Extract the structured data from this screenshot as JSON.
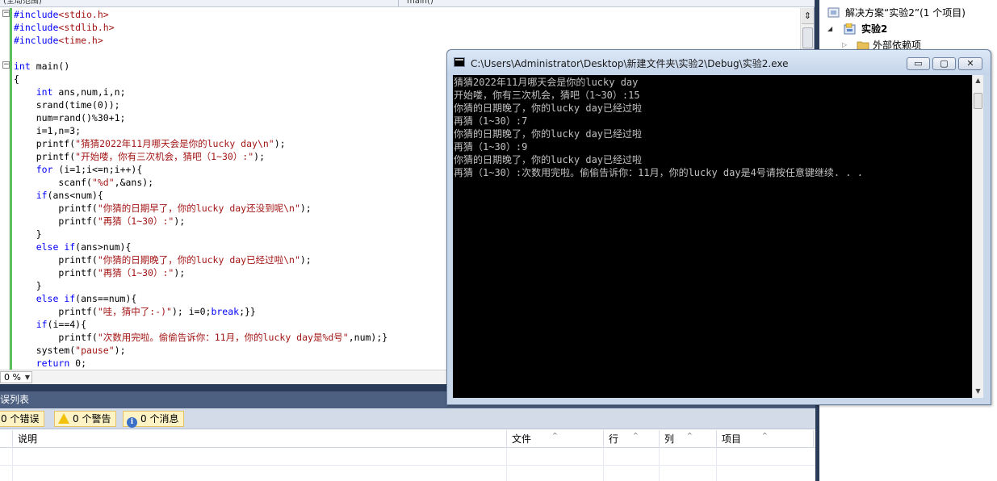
{
  "editor": {
    "nav_scope": "(全局范围)",
    "nav_function": "main()",
    "zoom_level": "0 %",
    "code_lines": [
      [
        {
          "t": "#include",
          "c": "pp"
        },
        {
          "t": "<stdio.h>",
          "c": "str"
        }
      ],
      [
        {
          "t": "#include",
          "c": "pp"
        },
        {
          "t": "<stdlib.h>",
          "c": "str"
        }
      ],
      [
        {
          "t": "#include",
          "c": "pp"
        },
        {
          "t": "<time.h>",
          "c": "str"
        }
      ],
      [],
      [
        {
          "t": "int",
          "c": "kw"
        },
        {
          "t": " main()",
          "c": ""
        }
      ],
      [
        {
          "t": "{",
          "c": ""
        }
      ],
      [
        {
          "t": "    ",
          "c": ""
        },
        {
          "t": "int",
          "c": "kw"
        },
        {
          "t": " ans,num,i,n;",
          "c": ""
        }
      ],
      [
        {
          "t": "    srand(time(0));",
          "c": ""
        }
      ],
      [
        {
          "t": "    num=rand()%30+1;",
          "c": ""
        }
      ],
      [
        {
          "t": "    i=1,n=3;",
          "c": ""
        }
      ],
      [
        {
          "t": "    printf(",
          "c": ""
        },
        {
          "t": "\"猜猜2022年11月哪天会是你的lucky day\\n\"",
          "c": "str"
        },
        {
          "t": ");",
          "c": ""
        }
      ],
      [
        {
          "t": "    printf(",
          "c": ""
        },
        {
          "t": "\"开始喽，你有三次机会，猜吧（1~30）:\"",
          "c": "str"
        },
        {
          "t": ");",
          "c": ""
        }
      ],
      [
        {
          "t": "    ",
          "c": ""
        },
        {
          "t": "for",
          "c": "kw"
        },
        {
          "t": " (i=1;i<=n;i++){",
          "c": ""
        }
      ],
      [
        {
          "t": "        scanf(",
          "c": ""
        },
        {
          "t": "\"%d\"",
          "c": "str"
        },
        {
          "t": ",&ans);",
          "c": ""
        }
      ],
      [
        {
          "t": "    ",
          "c": ""
        },
        {
          "t": "if",
          "c": "kw"
        },
        {
          "t": "(ans<num){",
          "c": ""
        }
      ],
      [
        {
          "t": "        printf(",
          "c": ""
        },
        {
          "t": "\"你猜的日期早了，你的lucky day还没到呢\\n\"",
          "c": "str"
        },
        {
          "t": ");",
          "c": ""
        }
      ],
      [
        {
          "t": "        printf(",
          "c": ""
        },
        {
          "t": "\"再猜（1~30）:\"",
          "c": "str"
        },
        {
          "t": ");",
          "c": ""
        }
      ],
      [
        {
          "t": "    }",
          "c": ""
        }
      ],
      [
        {
          "t": "    ",
          "c": ""
        },
        {
          "t": "else if",
          "c": "kw"
        },
        {
          "t": "(ans>num){",
          "c": ""
        }
      ],
      [
        {
          "t": "        printf(",
          "c": ""
        },
        {
          "t": "\"你猜的日期晚了，你的lucky day已经过啦\\n\"",
          "c": "str"
        },
        {
          "t": ");",
          "c": ""
        }
      ],
      [
        {
          "t": "        printf(",
          "c": ""
        },
        {
          "t": "\"再猜（1~30）:\"",
          "c": "str"
        },
        {
          "t": ");",
          "c": ""
        }
      ],
      [
        {
          "t": "    }",
          "c": ""
        }
      ],
      [
        {
          "t": "    ",
          "c": ""
        },
        {
          "t": "else if",
          "c": "kw"
        },
        {
          "t": "(ans==num){",
          "c": ""
        }
      ],
      [
        {
          "t": "        printf(",
          "c": ""
        },
        {
          "t": "\"哇，猜中了:-)\"",
          "c": "str"
        },
        {
          "t": "); i=0;",
          "c": ""
        },
        {
          "t": "break",
          "c": "kw"
        },
        {
          "t": ";}}",
          "c": ""
        }
      ],
      [
        {
          "t": "    ",
          "c": ""
        },
        {
          "t": "if",
          "c": "kw"
        },
        {
          "t": "(i==4){",
          "c": ""
        }
      ],
      [
        {
          "t": "        printf(",
          "c": ""
        },
        {
          "t": "\"次数用完啦。偷偷告诉你：11月，你的lucky day是%d号\"",
          "c": "str"
        },
        {
          "t": ",num);}",
          "c": ""
        }
      ],
      [
        {
          "t": "    system(",
          "c": ""
        },
        {
          "t": "\"pause\"",
          "c": "str"
        },
        {
          "t": ");",
          "c": ""
        }
      ],
      [
        {
          "t": "    ",
          "c": ""
        },
        {
          "t": "return",
          "c": "kw"
        },
        {
          "t": " 0;",
          "c": ""
        }
      ]
    ]
  },
  "error_list": {
    "title": "误列表",
    "errors_label": "0 个错误",
    "warnings_label": "0 个警告",
    "messages_label": "0 个消息",
    "columns": [
      "说明",
      "文件",
      "行",
      "列",
      "项目"
    ]
  },
  "solution_explorer": {
    "solution_label": "解决方案“实验2”(1 个项目)",
    "project_label": "实验2",
    "deps_label": "外部依赖项"
  },
  "console": {
    "title": "C:\\Users\\Administrator\\Desktop\\新建文件夹\\实验2\\Debug\\实验2.exe",
    "min_glyph": "▭",
    "max_glyph": "▢",
    "close_glyph": "✕",
    "lines": [
      "猜猜2022年11月哪天会是你的lucky day",
      "开始喽，你有三次机会，猜吧（1~30）:15",
      "你猜的日期晚了，你的lucky day已经过啦",
      "再猜（1~30）:7",
      "你猜的日期晚了，你的lucky day已经过啦",
      "再猜（1~30）:9",
      "你猜的日期晚了，你的lucky day已经过啦",
      "再猜（1~30）:次数用完啦。偷偷告诉你：11月，你的lucky day是4号请按任意键继续. . ."
    ]
  },
  "colors": {
    "keyword": "#0000ff",
    "string": "#a31515",
    "console_bg": "#000000",
    "console_fg": "#c0c0c0",
    "change_bar": "#5cc15c",
    "error_list_title_bg": "#4d6082"
  }
}
